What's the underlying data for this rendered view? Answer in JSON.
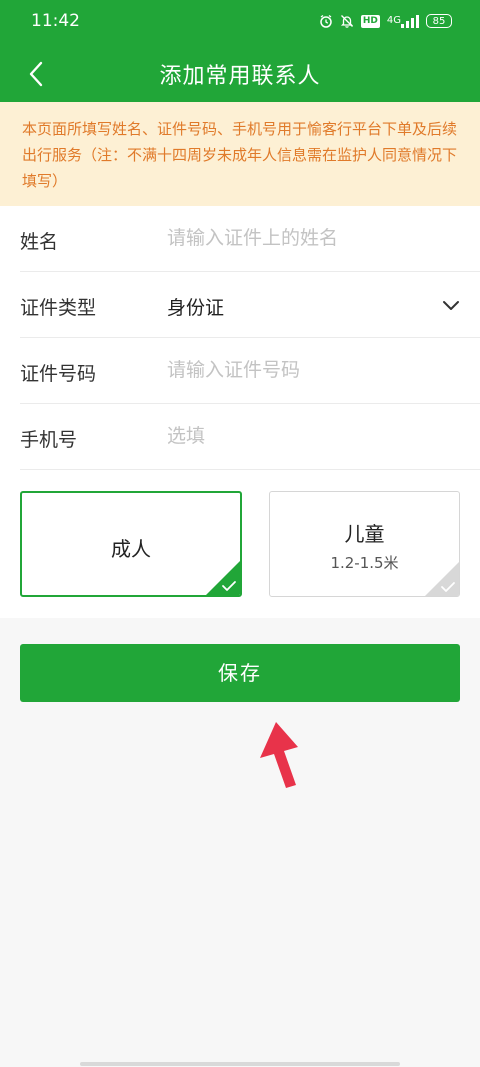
{
  "status_bar": {
    "time": "11:42",
    "hd_badge": "HD",
    "network": "4G",
    "battery": "85"
  },
  "header": {
    "title": "添加常用联系人",
    "back_icon": "chevron-left-icon"
  },
  "notice": {
    "text": "本页面所填写姓名、证件号码、手机号用于愉客行平台下单及后续出行服务（注：不满十四周岁未成年人信息需在监护人同意情况下填写）"
  },
  "form": {
    "name": {
      "label": "姓名",
      "placeholder": "请输入证件上的姓名",
      "value": ""
    },
    "id_type": {
      "label": "证件类型",
      "value": "身份证"
    },
    "id_number": {
      "label": "证件号码",
      "placeholder": "请输入证件号码",
      "value": ""
    },
    "phone": {
      "label": "手机号",
      "placeholder": "选填",
      "value": ""
    }
  },
  "passenger_types": [
    {
      "label": "成人",
      "sub": "",
      "selected": true
    },
    {
      "label": "儿童",
      "sub": "1.2-1.5米",
      "selected": false
    }
  ],
  "save_button": {
    "label": "保存"
  },
  "colors": {
    "brand_green": "#21a638",
    "notice_bg": "#fdf0d4",
    "notice_text": "#e07a2a",
    "arrow_red": "#e8334a"
  }
}
